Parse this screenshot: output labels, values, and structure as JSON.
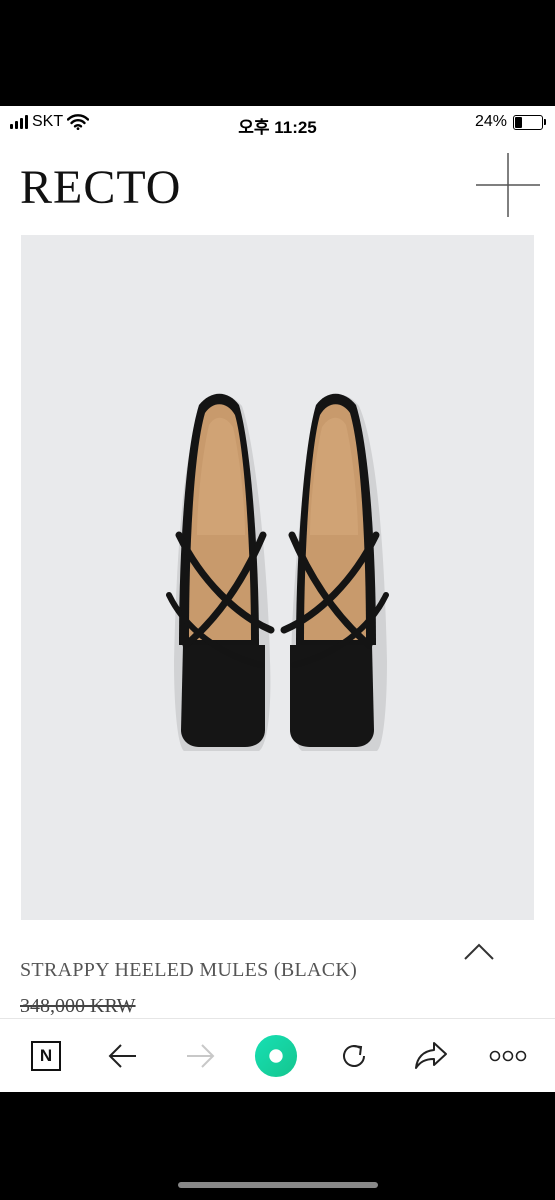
{
  "status_bar": {
    "carrier": "SKT",
    "time": "오후 11:25",
    "battery_percent": "24%",
    "battery_level": 0.24,
    "icons": [
      "signal-icon",
      "wifi-icon",
      "battery-icon"
    ]
  },
  "header": {
    "logo": "RECTO",
    "menu_icon": "plus-menu-icon"
  },
  "product": {
    "image_icon": "product-photo",
    "title": "STRAPPY HEELED MULES (BLACK)",
    "price": "348,000 KRW",
    "price_struck_through": true,
    "scroll_up_icon": "chevron-up-icon"
  },
  "browser_toolbar": {
    "home_label": "N",
    "icons": [
      "naver-home-icon",
      "back-arrow-icon",
      "forward-arrow-icon",
      "green-dot-icon",
      "reload-icon",
      "share-icon",
      "more-icon"
    ],
    "forward_enabled": false
  },
  "colors": {
    "image_background": "#e9eaec",
    "accent_green": "#1ed8a8",
    "text": "#111111"
  }
}
